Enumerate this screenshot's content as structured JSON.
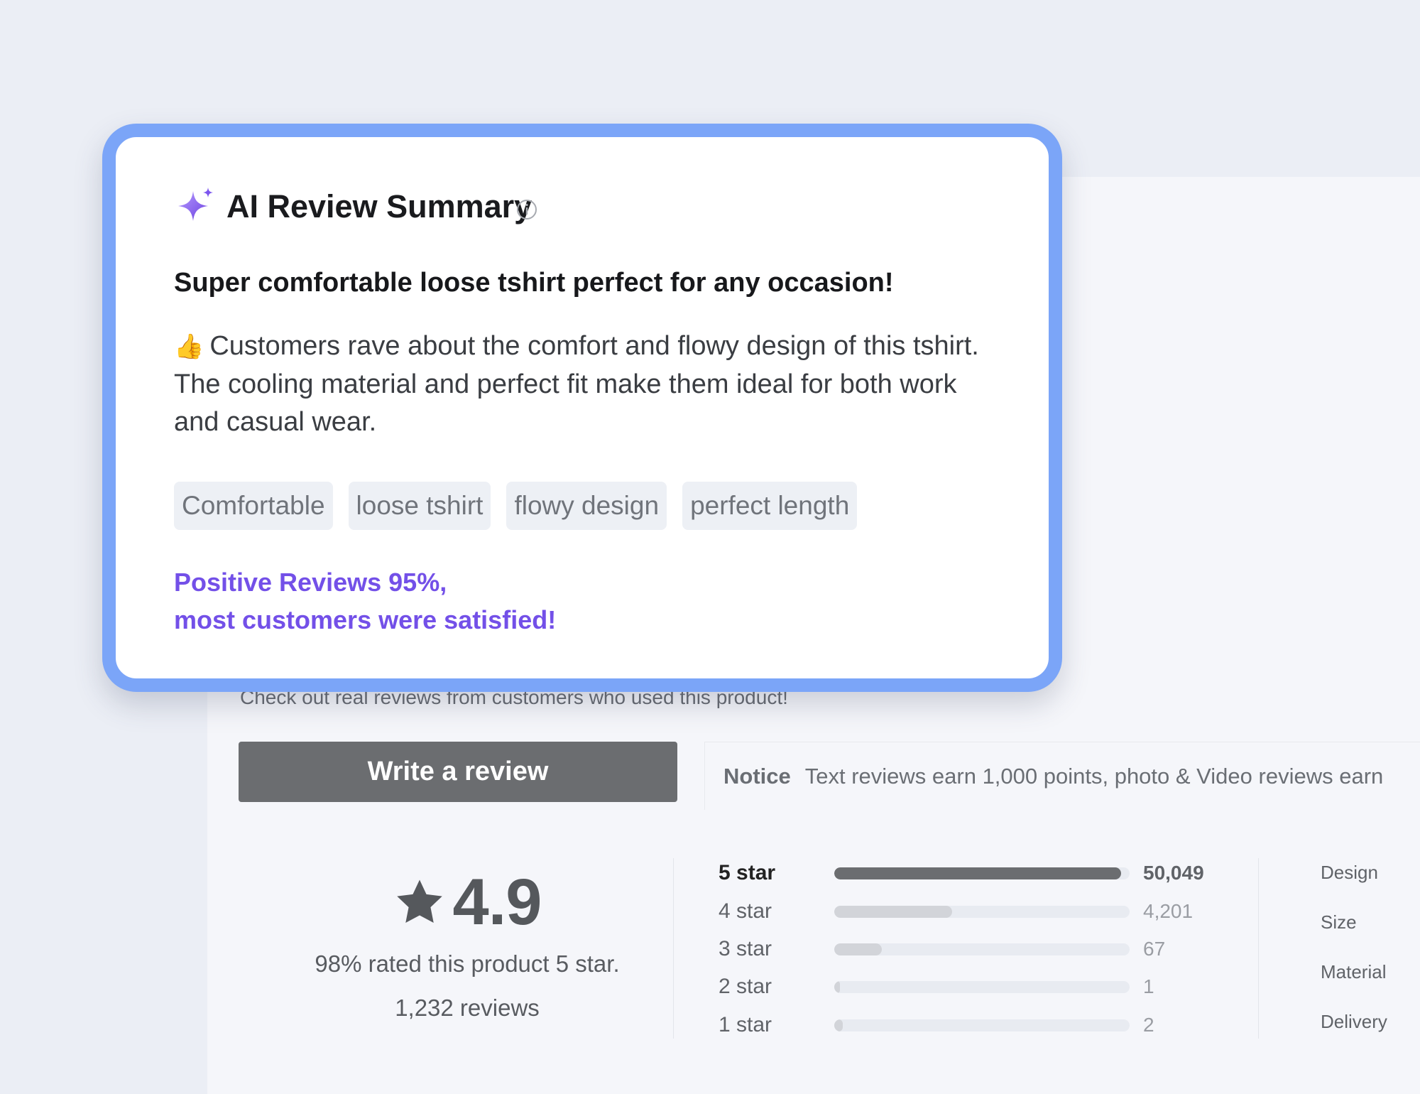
{
  "reviews_page": {
    "subtitle": "Check out real reviews from customers who used this product!",
    "write_review_label": "Write a review",
    "notice": {
      "label": "Notice",
      "text": "Text reviews earn 1,000 points, photo & Video reviews earn"
    },
    "rating": {
      "score": "4.9",
      "rated_text": "98% rated this product 5 star.",
      "review_count": "1,232 reviews"
    },
    "distribution": [
      {
        "label": "5 star",
        "count": "50,049",
        "fraction": 0.97
      },
      {
        "label": "4 star",
        "count": "4,201",
        "fraction": 0.4
      },
      {
        "label": "3 star",
        "count": "67",
        "fraction": 0.16
      },
      {
        "label": "2 star",
        "count": "1",
        "fraction": 0.02
      },
      {
        "label": "1 star",
        "count": "2",
        "fraction": 0.03
      }
    ],
    "categories": [
      "Design",
      "Size",
      "Material",
      "Delivery"
    ]
  },
  "ai_summary": {
    "title": "AI Review Summary",
    "headline": "Super comfortable loose tshirt perfect for any occasion!",
    "thumb_emoji": "👍",
    "body": "Customers rave about the comfort and flowy design of this tshirt. The cooling material and perfect fit make them ideal for both work and casual wear.",
    "tags": [
      "Comfortable",
      "loose tshirt",
      "flowy design",
      "perfect length"
    ],
    "positive_line1": "Positive Reviews 95%,",
    "positive_line2": "most customers were satisfied!"
  },
  "colors": {
    "card_border": "#7ba5f8",
    "accent_purple": "#7350e8",
    "button_bg": "#6b6d70"
  },
  "icons": [
    "sparkle-star-icon",
    "info-icon",
    "star-icon",
    "thumbs-up-icon"
  ]
}
